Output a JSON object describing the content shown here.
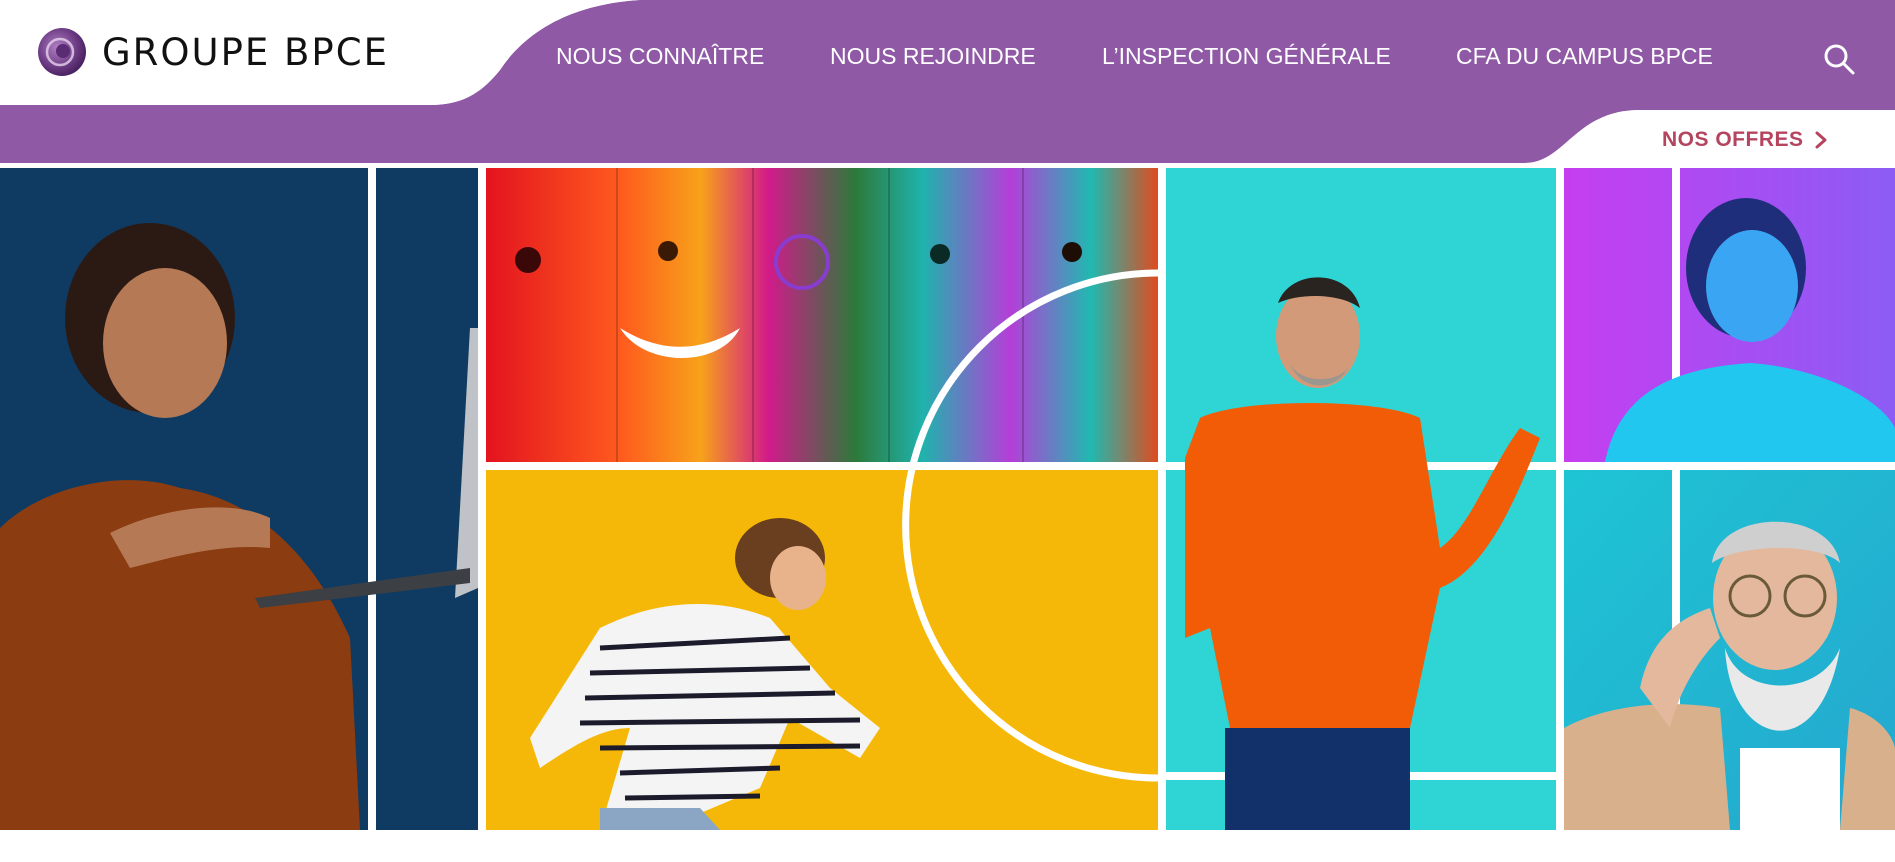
{
  "brand": {
    "name": "GROUPE BPCE",
    "purple": "#8f59a6",
    "accent": "#b5455f"
  },
  "nav": {
    "items": [
      {
        "label": "NOUS CONNAÎTRE"
      },
      {
        "label": "NOUS REJOINDRE"
      },
      {
        "label": "L’INSPECTION GÉNÉRALE"
      },
      {
        "label": "CFA DU CAMPUS BPCE"
      }
    ],
    "search_icon": "search-icon"
  },
  "subnav": {
    "offers_label": "NOS OFFRES",
    "offers_icon": "chevron-right-icon"
  },
  "hero": {
    "panels": [
      {
        "name": "woman-with-laptop",
        "bg": "#0f3b63"
      },
      {
        "name": "faces-strip",
        "bg": "#e0261f"
      },
      {
        "name": "running-woman",
        "bg": "#f6b808"
      },
      {
        "name": "man-orange-shirt",
        "bg": "#2fd4d4"
      },
      {
        "name": "woman-blue",
        "bg": "#b13ee8"
      },
      {
        "name": "bearded-man",
        "bg": "#1fb8cf"
      }
    ]
  }
}
